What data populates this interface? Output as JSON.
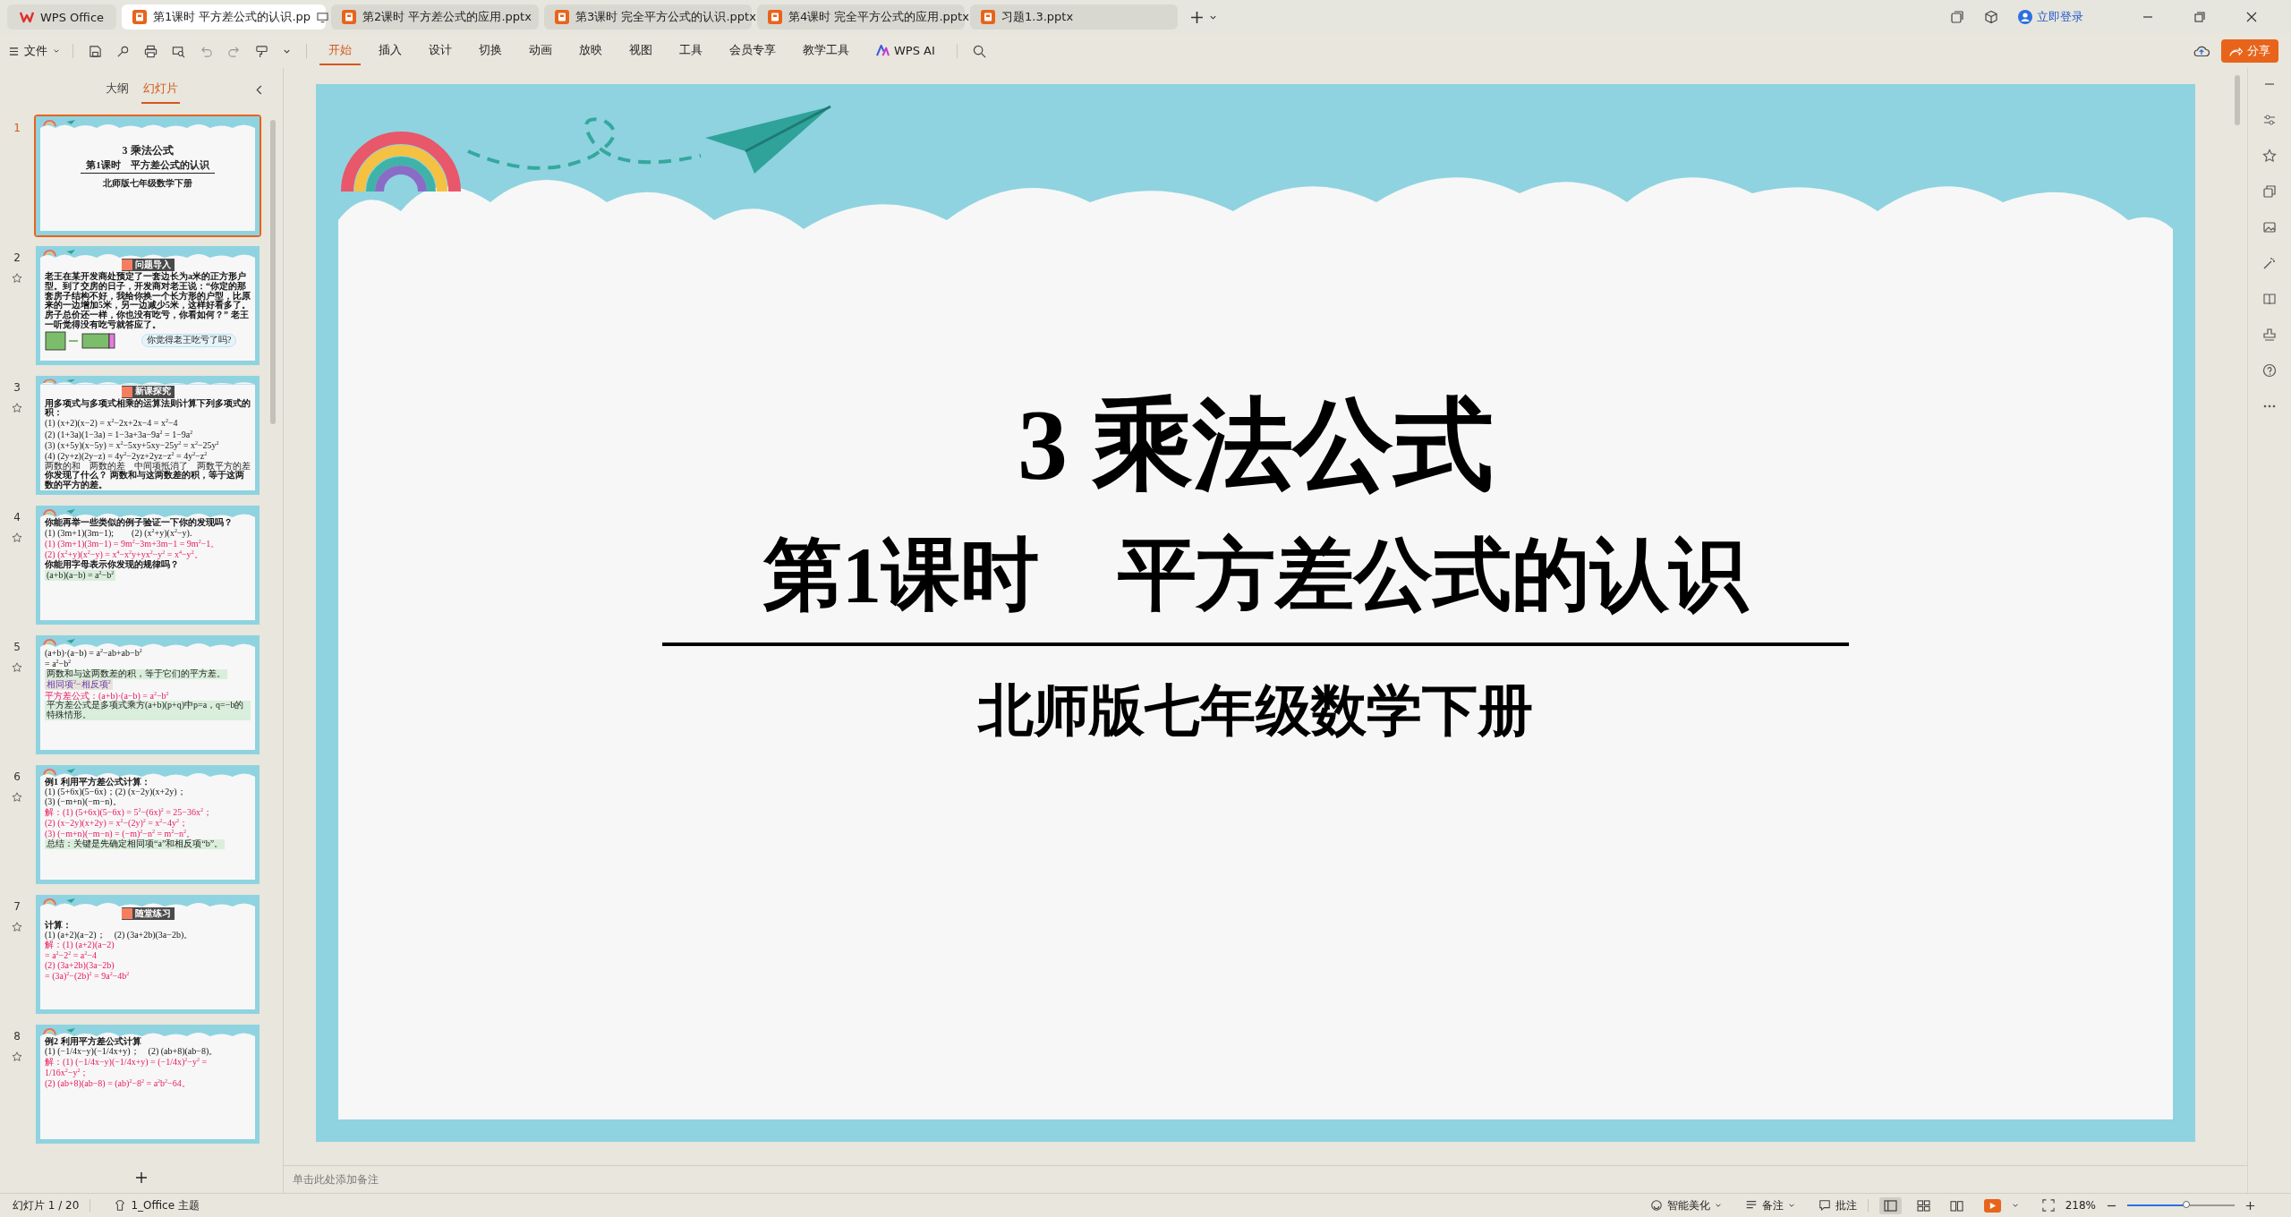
{
  "app_name": "WPS Office",
  "doc_tabs": [
    {
      "label": "第1课时 平方差公式的认识.pp",
      "selected": true
    },
    {
      "label": "第2课时  平方差公式的应用.pptx",
      "selected": false
    },
    {
      "label": "第3课时  完全平方公式的认识.pptx",
      "selected": false
    },
    {
      "label": "第4课时  完全平方公式的应用.pptx",
      "selected": false
    },
    {
      "label": "习题1.3.pptx",
      "selected": false
    }
  ],
  "login": "立即登录",
  "file_menu": "文件",
  "ribbon_tabs": [
    {
      "label": "开始",
      "selected": true
    },
    {
      "label": "插入",
      "selected": false
    },
    {
      "label": "设计",
      "selected": false
    },
    {
      "label": "切换",
      "selected": false
    },
    {
      "label": "动画",
      "selected": false
    },
    {
      "label": "放映",
      "selected": false
    },
    {
      "label": "视图",
      "selected": false
    },
    {
      "label": "工具",
      "selected": false
    },
    {
      "label": "会员专享",
      "selected": false
    },
    {
      "label": "教学工具",
      "selected": false
    },
    {
      "label": "WPS AI",
      "selected": false
    }
  ],
  "share": "分享",
  "sidebar": {
    "tabs": [
      {
        "label": "大纲",
        "selected": false
      },
      {
        "label": "幻灯片",
        "selected": true
      }
    ],
    "slides": [
      {
        "number": "1",
        "selected": true,
        "items": [
          {
            "kind": "title",
            "text": "3  乘法公式"
          },
          {
            "kind": "subtitle",
            "text": "第1课时　平方差公式的认识"
          },
          {
            "kind": "caption",
            "text": "北师版七年级数学下册"
          }
        ]
      },
      {
        "number": "2",
        "selected": false,
        "items": [
          {
            "kind": "banner",
            "text": "问题导入"
          },
          {
            "kind": "text",
            "text": "老王在某开发商处预定了一套边长为a米的正方形户型。到了交房的日子，开发商对老王说：“你定的那套房子结构不好，我给你换一个长方形的户型，比原来的一边增加5米，另一边减少5米，这样好看多了。房子总价还一样，你也没有吃亏，你看如何？” 老王一听觉得没有吃亏就答应了。"
          },
          {
            "kind": "squares",
            "text": "你觉得老王吃亏了吗?"
          }
        ]
      },
      {
        "number": "3",
        "selected": false,
        "items": [
          {
            "kind": "banner",
            "text": "新课探究"
          },
          {
            "kind": "text",
            "text": "用多项式与多项式相乘的运算法则计算下列多项式的积："
          },
          {
            "kind": "formula",
            "text": "(1) (x+2)(x−2) = x$^{2}$−2x+2x−4 = x$^{2}$−4"
          },
          {
            "kind": "formula",
            "text": "(2) (1+3a)(1−3a) = 1−3a+3a−9a$^{2}$ = 1−9a$^{2}$"
          },
          {
            "kind": "formula",
            "text": "(3) (x+5y)(x−5y) = x$^{2}$−5xy+5xy−25y$^{2}$ = x$^{2}$−25y$^{2}$"
          },
          {
            "kind": "formula",
            "text": "(4) (2y+z)(2y−z) = 4y$^{2}$−2yz+2yz−z$^{2}$ = 4y$^{2}$−z$^{2}$"
          },
          {
            "kind": "labels",
            "text": "两数的和　两数的差　中间项抵消了　两数平方的差"
          },
          {
            "kind": "text",
            "text": "你发现了什么？ 两数和与这两数差的积，等于这两数的平方的差。"
          }
        ]
      },
      {
        "number": "4",
        "selected": false,
        "items": [
          {
            "kind": "text",
            "text": "你能再举一些类似的例子验证一下你的发现吗？"
          },
          {
            "kind": "formula",
            "text": "(1) (3m+1)(3m−1);　　(2) (x$^{2}$+y)(x$^{2}$−y)."
          },
          {
            "kind": "answer",
            "text": "(1) (3m+1)(3m−1) = 9m$^{2}$−3m+3m−1 = 9m$^{2}$−1。"
          },
          {
            "kind": "answer",
            "text": "(2) (x$^{2}$+y)(x$^{2}$−y) = x$^{4}$−x$^{2}$y+yx$^{2}$−y$^{2}$ = x$^{4}$−y$^{2}$。"
          },
          {
            "kind": "text",
            "text": "你能用字母表示你发现的规律吗？"
          },
          {
            "kind": "highlight",
            "text": "(a+b)(a−b) = a$^{2}$−b$^{2}$"
          }
        ]
      },
      {
        "number": "5",
        "selected": false,
        "items": [
          {
            "kind": "formula",
            "text": "(a+b)·(a−b) = a$^{2}$−ab+ab−b$^{2}$"
          },
          {
            "kind": "formula",
            "text": "= a$^{2}$−b$^{2}$"
          },
          {
            "kind": "highlight",
            "text": "两数和与这两数差的积，等于它们的平方差。"
          },
          {
            "kind": "note",
            "text": "相同项$^{2}$−相反项$^{2}$"
          },
          {
            "kind": "answer",
            "text": "平方差公式：(a+b)·(a−b) = a$^{2}$−b$^{2}$"
          },
          {
            "kind": "highlight",
            "text": "平方差公式是多项式乘方(a+b)(p+q)中p=a，q=−b的特殊情形。"
          }
        ]
      },
      {
        "number": "6",
        "selected": false,
        "items": [
          {
            "kind": "text",
            "text": "例1  利用平方差公式计算："
          },
          {
            "kind": "formula",
            "text": "(1) (5+6x)(5−6x)；(2) (x−2y)(x+2y)；"
          },
          {
            "kind": "formula",
            "text": "(3) (−m+n)(−m−n)。"
          },
          {
            "kind": "answer",
            "text": "解：(1) (5+6x)(5−6x) = 5$^{2}$−(6x)$^{2}$ = 25−36x$^{2}$；"
          },
          {
            "kind": "answer",
            "text": "(2) (x−2y)(x+2y) = x$^{2}$−(2y)$^{2}$ = x$^{2}$−4y$^{2}$；"
          },
          {
            "kind": "answer",
            "text": "(3) (−m+n)(−m−n) = (−m)$^{2}$−n$^{2}$ = m$^{2}$−n$^{2}$。"
          },
          {
            "kind": "highlight",
            "text": "总结：关键是先确定相同项“a”和相反项“b”。"
          }
        ]
      },
      {
        "number": "7",
        "selected": false,
        "items": [
          {
            "kind": "banner",
            "text": "随堂练习"
          },
          {
            "kind": "text",
            "text": "计算："
          },
          {
            "kind": "formula",
            "text": "(1) (a+2)(a−2)；　(2) (3a+2b)(3a−2b)。"
          },
          {
            "kind": "answer",
            "text": "解：(1) (a+2)(a−2)"
          },
          {
            "kind": "answer",
            "text": "= a$^{2}$−2$^{2}$ = a$^{2}$−4"
          },
          {
            "kind": "answer",
            "text": "(2) (3a+2b)(3a−2b)"
          },
          {
            "kind": "answer",
            "text": "= (3a)$^{2}$−(2b)$^{2}$ = 9a$^{2}$−4b$^{2}$"
          }
        ]
      },
      {
        "number": "8",
        "selected": false,
        "items": [
          {
            "kind": "text",
            "text": "例2  利用平方差公式计算"
          },
          {
            "kind": "formula",
            "text": "(1) (−1/4x−y)(−1/4x+y)；　(2) (ab+8)(ab−8)。"
          },
          {
            "kind": "answer",
            "text": "解：(1) (−1/4x−y)(−1/4x+y) = (−1/4x)$^{2}$−y$^{2}$ = 1/16x$^{2}$−y$^{2}$；"
          },
          {
            "kind": "answer",
            "text": "(2) (ab+8)(ab−8) = (ab)$^{2}$−8$^{2}$ = a$^{2}$b$^{2}$−64。"
          }
        ]
      }
    ]
  },
  "slide": {
    "title": "3  乘法公式",
    "subtitle": "第1课时　平方差公式的认识",
    "caption": "北师版七年级数学下册"
  },
  "notes_placeholder": "单击此处添加备注",
  "status_bar": {
    "slide_count": "幻灯片 1 / 20",
    "theme": "1_Office 主题",
    "beautify": "智能美化",
    "notes": "备注",
    "comments": "批注",
    "views": [
      {
        "kind": "normal",
        "selected": true
      },
      {
        "kind": "sorter",
        "selected": false
      },
      {
        "kind": "reading",
        "selected": false
      }
    ],
    "zoom": "218%",
    "zoom_slider": {
      "level": 0.55
    }
  }
}
